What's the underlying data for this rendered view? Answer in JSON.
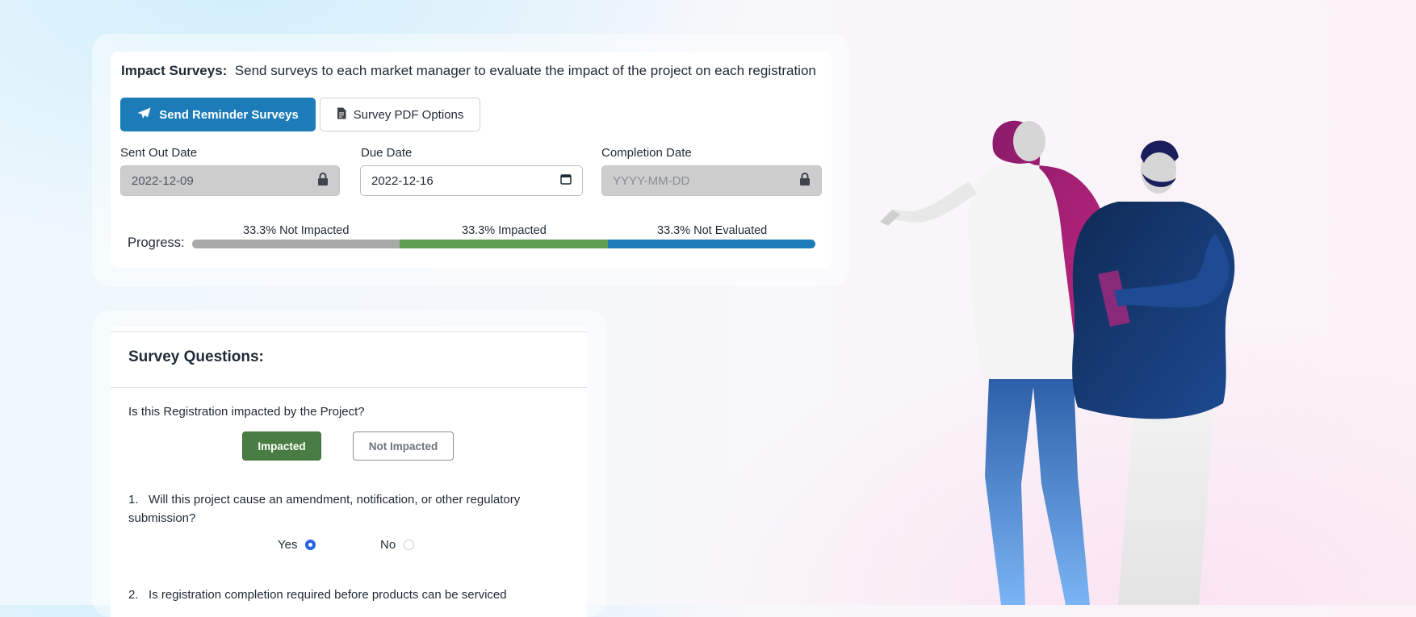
{
  "impact": {
    "header_title": "Impact Surveys:",
    "header_desc": "Send surveys to each market manager to evaluate the impact of the project on each registration",
    "send_reminder_label": "Send Reminder Surveys",
    "pdf_options_label": "Survey PDF Options",
    "fields": {
      "sent_out": {
        "label": "Sent Out Date",
        "value": "2022-12-09",
        "locked": true
      },
      "due": {
        "label": "Due Date",
        "value": "2022-12-16"
      },
      "completion": {
        "label": "Completion Date",
        "placeholder": "YYYY-MM-DD",
        "locked": true
      }
    },
    "progress": {
      "label": "Progress:",
      "segments": [
        {
          "label": "33.3% Not Impacted",
          "percent": 33.3,
          "color": "#a9a9a9"
        },
        {
          "label": "33.3% Impacted",
          "percent": 33.3,
          "color": "#5d9e52"
        },
        {
          "label": "33.3% Not Evaluated",
          "percent": 33.3,
          "color": "#1b7cb8"
        }
      ]
    }
  },
  "survey": {
    "title": "Survey Questions:",
    "main_question": "Is this Registration impacted by the Project?",
    "impacted_label": "Impacted",
    "not_impacted_label": "Not Impacted",
    "selected": "Impacted",
    "questions": [
      {
        "number": "1.",
        "text": "Will this project cause an amendment, notification, or other regulatory submission?",
        "yes_label": "Yes",
        "no_label": "No",
        "answer": "Yes"
      },
      {
        "number": "2.",
        "text": "Is registration completion required before products can be serviced"
      }
    ]
  },
  "colors": {
    "primary": "#1b7cb8",
    "impacted_green": "#4a7d43",
    "radio_blue": "#2563eb"
  }
}
